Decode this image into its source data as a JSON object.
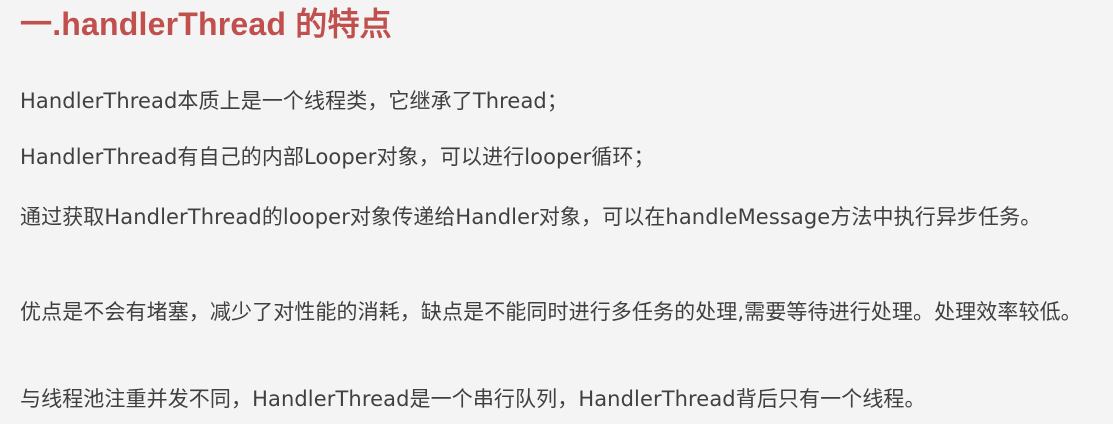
{
  "title": "一.handlerThread 的特点",
  "paragraphs": [
    "HandlerThread本质上是一个线程类，它继承了Thread；",
    "HandlerThread有自己的内部Looper对象，可以进行looper循环；",
    "通过获取HandlerThread的looper对象传递给Handler对象，可以在handleMessage方法中执行异步任务。",
    "优点是不会有堵塞，减少了对性能的消耗，缺点是不能同时进行多任务的处理,需要等待进行处理。处理效率较低。",
    "与线程池注重并发不同，HandlerThread是一个串行队列，HandlerThread背后只有一个线程。"
  ],
  "colors": {
    "background": "#f4f4f4",
    "title": "#c0504d",
    "text": "#404040"
  }
}
